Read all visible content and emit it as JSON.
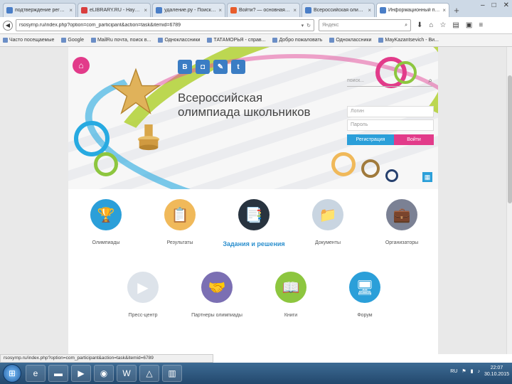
{
  "tabs": [
    {
      "title": "подтверждение регист...",
      "color": "#4a7ec7"
    },
    {
      "title": "eLIBRARY.RU - Наукова...",
      "color": "#d93e3e"
    },
    {
      "title": "удаление.ру - Поиск в ...",
      "color": "#4a7ec7"
    },
    {
      "title": "Войти? — основная ми...",
      "color": "#e85c2b"
    },
    {
      "title": "Всероссийская олимп...",
      "color": "#4a7ec7"
    },
    {
      "title": "Информационный портал...",
      "color": "#4a7ec7",
      "active": true
    }
  ],
  "browser": {
    "url": "rsosyrnp.ru/index.php?option=com_participant&action=task&itemid=6789",
    "search_placeholder": "Яндекс",
    "bookmarks": [
      "Часто посещаемые",
      "Google",
      "MailRu почта, поиск в...",
      "Одноклассники",
      "ТАТАМОРЬЯ - справ...",
      "Добро пожаловать",
      "Одноклассники",
      "MayKazantsevich - Ви..."
    ]
  },
  "site": {
    "title_line1": "Всероссийская",
    "title_line2": "олимпиада школьников",
    "search_placeholder": "поиск...",
    "login_placeholder": "Логин",
    "password_placeholder": "Пароль",
    "register_label": "Регистрация",
    "login_label": "Войти"
  },
  "tiles": [
    {
      "label": "Олимпиады",
      "color": "#2b9fd9",
      "glyph": "🏆"
    },
    {
      "label": "Результаты",
      "color": "#f0b95a",
      "glyph": "📋"
    },
    {
      "label": "Задания и решения",
      "color": "#28333f",
      "glyph": "📑",
      "active": true
    },
    {
      "label": "Документы",
      "color": "#c9d5e1",
      "glyph": "📁"
    },
    {
      "label": "Организаторы",
      "color": "#7b8194",
      "glyph": "💼"
    },
    {
      "label": "Пресс-центр",
      "color": "#dde3ea",
      "glyph": "▶"
    },
    {
      "label": "Партнеры олимпиады",
      "color": "#7b6fb3",
      "glyph": "🤝"
    },
    {
      "label": "Книги",
      "color": "#8dc63f",
      "glyph": "📖"
    },
    {
      "label": "Форум",
      "color": "#2b9fd9",
      "glyph": "🖥"
    }
  ],
  "status_url": "rsosyrnp.ru/index.php?option=com_participant&action=task&itemid=6789",
  "taskbar": {
    "time": "22:07",
    "date": "30.10.2015",
    "lang": "RU"
  },
  "colors": {
    "pink": "#e23b8a",
    "blue": "#2b9fd9",
    "green": "#8dc63f"
  }
}
